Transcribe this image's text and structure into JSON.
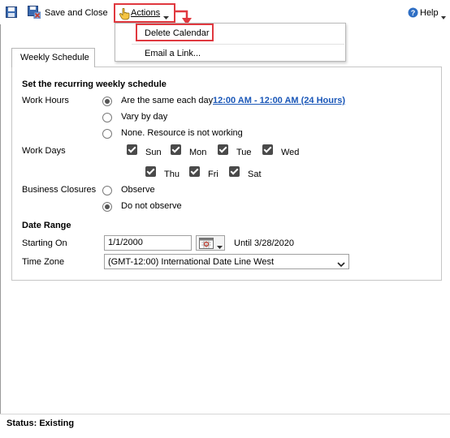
{
  "toolbar": {
    "save_and_close_label": "Save and Close",
    "actions_label": "Actions",
    "help_label": "Help"
  },
  "actions_menu": {
    "items": [
      "Delete Calendar",
      "Email a Link..."
    ]
  },
  "tab": {
    "label": "Weekly Schedule"
  },
  "schedule": {
    "heading": "Set the recurring weekly schedule",
    "work_hours_label": "Work Hours",
    "work_hours_options": [
      "Are the same each day",
      "Vary by day",
      "None. Resource is not working"
    ],
    "work_hours_selected": "Are the same each day",
    "hours_link": "12:00 AM - 12:00 AM (24 Hours)",
    "work_days_label": "Work Days",
    "days": [
      {
        "label": "Sun",
        "checked": true
      },
      {
        "label": "Mon",
        "checked": true
      },
      {
        "label": "Tue",
        "checked": true
      },
      {
        "label": "Wed",
        "checked": true
      },
      {
        "label": "Thu",
        "checked": true
      },
      {
        "label": "Fri",
        "checked": true
      },
      {
        "label": "Sat",
        "checked": true
      }
    ],
    "business_closures_label": "Business Closures",
    "closure_options": [
      "Observe",
      "Do not observe"
    ],
    "closure_selected": "Do not observe"
  },
  "date_range": {
    "heading": "Date Range",
    "starting_on_label": "Starting On",
    "starting_on_value": "1/1/2000",
    "until_text": "Until 3/28/2020",
    "time_zone_label": "Time Zone",
    "time_zone_value": "(GMT-12:00) International Date Line West"
  },
  "status": {
    "text": "Status: Existing"
  },
  "colors": {
    "callout": "#e0383f",
    "link": "#1a57b8"
  }
}
